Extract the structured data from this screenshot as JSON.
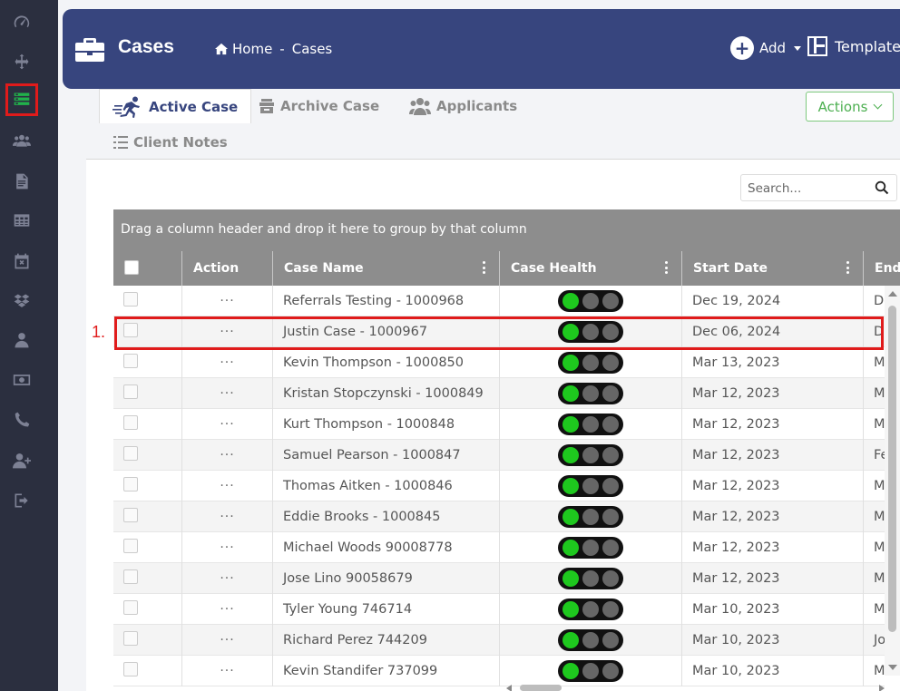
{
  "sidebar": {
    "icons": [
      "dashboard-icon",
      "move-icon",
      "cases-list-icon",
      "users-group-icon",
      "document-icon",
      "table-icon",
      "calendar-x-icon",
      "dropbox-icon",
      "user-icon",
      "money-icon",
      "phone-icon",
      "user-add-icon",
      "logout-icon"
    ],
    "active": "cases-list-icon",
    "active_color": "#21b24b"
  },
  "header": {
    "title": "Cases",
    "breadcrumb": {
      "home": "Home",
      "separator": "-",
      "current": "Cases"
    },
    "add_label": "Add",
    "template_label": "Template",
    "background": "#37457e"
  },
  "tabs": [
    {
      "label": "Active Case",
      "icon": "running-man-icon",
      "active": true
    },
    {
      "label": "Archive Case",
      "icon": "archive-box-icon",
      "active": false
    },
    {
      "label": "Applicants",
      "icon": "users-icon",
      "active": false
    },
    {
      "label": "Client Notes",
      "icon": "list-icon",
      "active": false
    }
  ],
  "actions_label": "Actions",
  "search": {
    "placeholder": "Search..."
  },
  "grid": {
    "group_hint": "Drag a column header and drop it here to group by that column",
    "columns": [
      "Action",
      "Case Name",
      "Case Health",
      "Start Date",
      "End"
    ],
    "rows": [
      {
        "action": "···",
        "case_name": "Referrals Testing - 1000968",
        "health": [
          "green",
          "grey",
          "grey"
        ],
        "start_date": "Dec 19, 2024",
        "end": "De"
      },
      {
        "action": "···",
        "case_name": "Justin Case - 1000967",
        "health": [
          "green",
          "grey",
          "grey"
        ],
        "start_date": "Dec 06, 2024",
        "end": "D"
      },
      {
        "action": "···",
        "case_name": "Kevin Thompson - 1000850",
        "health": [
          "green",
          "grey",
          "grey"
        ],
        "start_date": "Mar 13, 2023",
        "end": "M"
      },
      {
        "action": "···",
        "case_name": "Kristan Stopczynski - 1000849",
        "health": [
          "green",
          "grey",
          "grey"
        ],
        "start_date": "Mar 12, 2023",
        "end": "M"
      },
      {
        "action": "···",
        "case_name": "Kurt Thompson - 1000848",
        "health": [
          "green",
          "grey",
          "grey"
        ],
        "start_date": "Mar 12, 2023",
        "end": "M"
      },
      {
        "action": "···",
        "case_name": "Samuel Pearson - 1000847",
        "health": [
          "green",
          "grey",
          "grey"
        ],
        "start_date": "Mar 12, 2023",
        "end": "Fe"
      },
      {
        "action": "···",
        "case_name": "Thomas Aitken - 1000846",
        "health": [
          "green",
          "grey",
          "grey"
        ],
        "start_date": "Mar 12, 2023",
        "end": "M"
      },
      {
        "action": "···",
        "case_name": "Eddie Brooks - 1000845",
        "health": [
          "green",
          "grey",
          "grey"
        ],
        "start_date": "Mar 12, 2023",
        "end": "M"
      },
      {
        "action": "···",
        "case_name": "Michael Woods 90008778",
        "health": [
          "green",
          "grey",
          "grey"
        ],
        "start_date": "Mar 12, 2023",
        "end": "M"
      },
      {
        "action": "···",
        "case_name": "Jose Lino 90058679",
        "health": [
          "green",
          "grey",
          "grey"
        ],
        "start_date": "Mar 12, 2023",
        "end": "M"
      },
      {
        "action": "···",
        "case_name": "Tyler Young 746714",
        "health": [
          "green",
          "grey",
          "grey"
        ],
        "start_date": "Mar 10, 2023",
        "end": "M"
      },
      {
        "action": "···",
        "case_name": "Richard Perez 744209",
        "health": [
          "green",
          "grey",
          "grey"
        ],
        "start_date": "Mar 10, 2023",
        "end": "Jo"
      },
      {
        "action": "···",
        "case_name": "Kevin Standifer 737099",
        "health": [
          "green",
          "grey",
          "grey"
        ],
        "start_date": "Mar 10, 2023",
        "end": "M"
      }
    ]
  },
  "annotation": {
    "label": "1.",
    "color": "#e01b1b",
    "highlighted_row": "Justin Case - 1000967"
  }
}
